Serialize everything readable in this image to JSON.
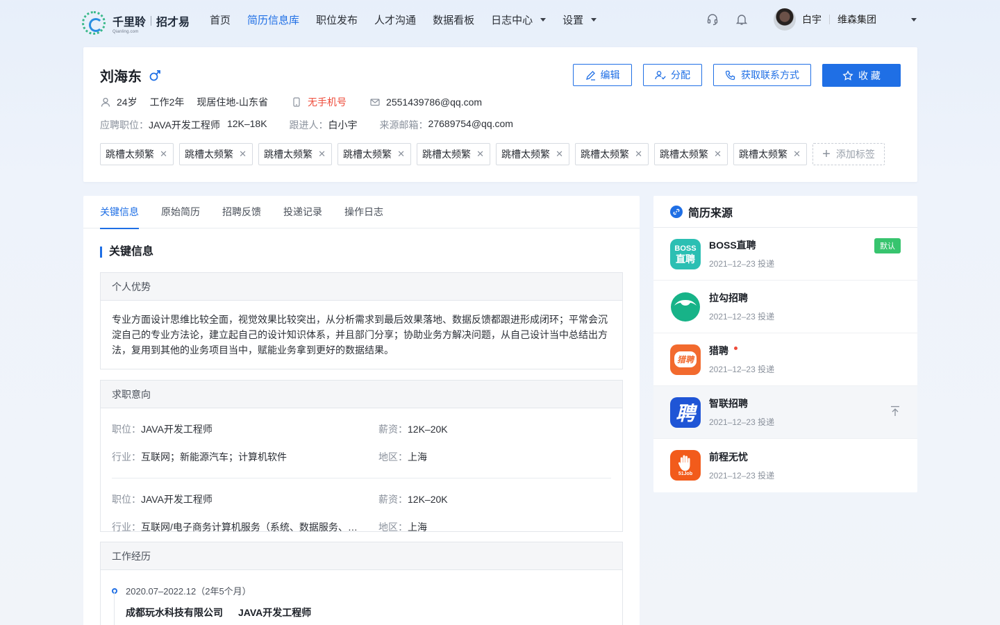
{
  "brand": {
    "name": "千里聆",
    "product": "招才易",
    "sub": "Qianling.com"
  },
  "nav": {
    "items": [
      {
        "label": "首页"
      },
      {
        "label": "简历信息库",
        "active": true
      },
      {
        "label": "职位发布"
      },
      {
        "label": "人才沟通"
      },
      {
        "label": "数据看板"
      },
      {
        "label": "日志中心",
        "dropdown": true
      },
      {
        "label": "设置",
        "dropdown": true
      }
    ],
    "user": "白宇",
    "company": "维森集团"
  },
  "profile": {
    "name": "刘海东",
    "age": "24岁",
    "experience": "工作2年",
    "residence": "现居住地-山东省",
    "phone": "无手机号",
    "email": "2551439786@qq.com",
    "position_label": "应聘职位：",
    "position": "JAVA开发工程师",
    "salary": "12K–18K",
    "follower_label": "跟进人：",
    "follower": "白小宇",
    "source_email_label": "来源邮箱：",
    "source_email": "27689754@qq.com",
    "actions": {
      "edit": "编辑",
      "assign": "分配",
      "contact": "获取联系方式",
      "favorite": "收 藏"
    },
    "tags": [
      "跳槽太频繁",
      "跳槽太频繁",
      "跳槽太频繁",
      "跳槽太频繁",
      "跳槽太频繁",
      "跳槽太频繁",
      "跳槽太频繁",
      "跳槽太频繁",
      "跳槽太频繁"
    ],
    "add_tag": "添加标签"
  },
  "tabs": [
    "关键信息",
    "原始简历",
    "招聘反馈",
    "投递记录",
    "操作日志"
  ],
  "key_info": {
    "title": "关键信息",
    "advantage": {
      "head": "个人优势",
      "text": "专业方面设计思维比较全面，视觉效果比较突出，从分析需求到最后效果落地、数据反馈都跟进形成闭环；平常会沉淀自己的专业方法论，建立起自己的设计知识体系，并且部门分享；协助业务方解决问题，从自己设计当中总结出方法，复用到其他的业务项目当中，赋能业务拿到更好的数据结果。"
    },
    "intent": {
      "head": "求职意向",
      "labels": {
        "position": "职位：",
        "salary": "薪资：",
        "industry": "行业：",
        "region": "地区："
      },
      "items": [
        {
          "position": "JAVA开发工程师",
          "salary": "12K–20K",
          "industry": "互联网；新能源汽车；计算机软件",
          "region": "上海"
        },
        {
          "position": "JAVA开发工程师",
          "salary": "12K–20K",
          "industry": "互联网/电子商务计算机服务（系统、数据服务、…",
          "region": "上海"
        }
      ]
    },
    "work": {
      "head": "工作经历",
      "items": [
        {
          "period": "2020.07–2022.12（2年5个月）",
          "company": "成都玩水科技有限公司",
          "title": "JAVA开发工程师"
        }
      ]
    }
  },
  "source": {
    "title": "简历来源",
    "default_badge": "默认",
    "items": [
      {
        "name": "BOSS直聘",
        "date": "2021–12–23 投递",
        "logo_text": "BOSS直聘",
        "color": "#2bbfb3"
      },
      {
        "name": "拉勾招聘",
        "date": "2021–12–23 投递",
        "color": "#17b388"
      },
      {
        "name": "猎聘",
        "date": "2021–12–23 投递",
        "logo_text": "猎聘",
        "color": "#f26a2e"
      },
      {
        "name": "智联招聘",
        "date": "2021–12–23 投递",
        "logo_text": "聘",
        "color": "#1f55d6"
      },
      {
        "name": "前程无忧",
        "date": "2021–12–23 投递",
        "logo_text": "51Job",
        "color": "#f25b1b"
      }
    ]
  }
}
